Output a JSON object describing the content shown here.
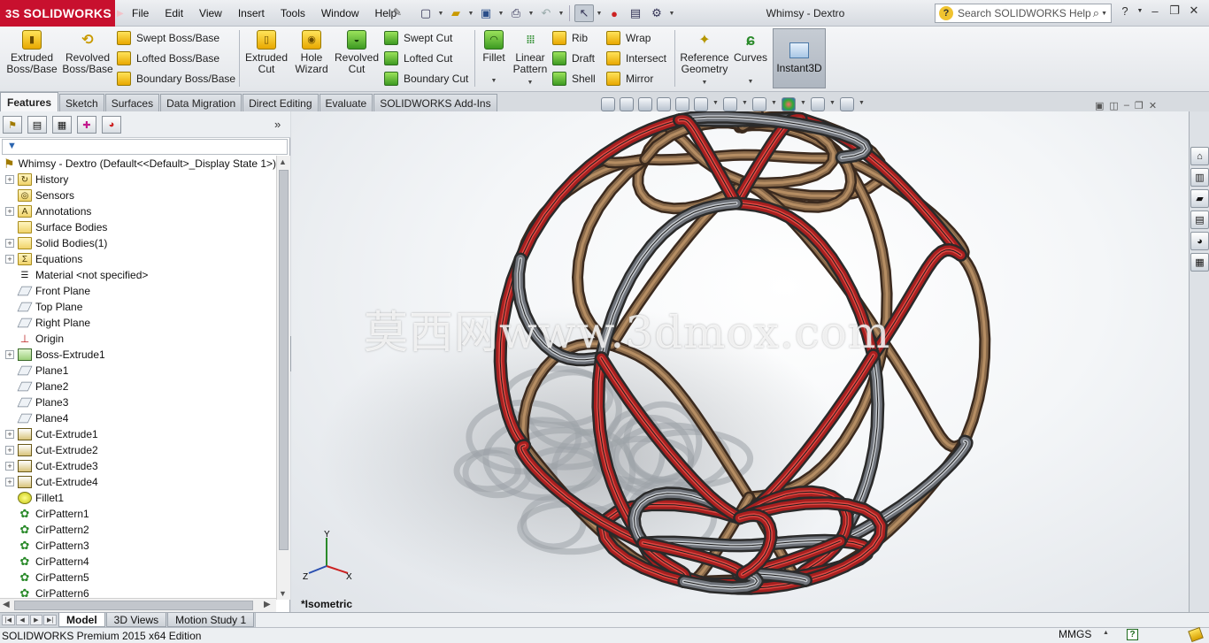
{
  "app": {
    "brand": "SOLIDWORKS",
    "brand_prefix": "3S",
    "window_title": "Whimsy - Dextro",
    "brand_color": "#c8102e"
  },
  "menu": [
    "File",
    "Edit",
    "View",
    "Insert",
    "Tools",
    "Window",
    "Help"
  ],
  "search": {
    "placeholder": "Search SOLIDWORKS Help"
  },
  "ribbon": {
    "extruded_boss": "Extruded Boss/Base",
    "revolved_boss": "Revolved Boss/Base",
    "swept_boss": "Swept Boss/Base",
    "lofted_boss": "Lofted Boss/Base",
    "boundary_boss": "Boundary Boss/Base",
    "extruded_cut": "Extruded Cut",
    "hole_wizard": "Hole Wizard",
    "revolved_cut": "Revolved Cut",
    "swept_cut": "Swept Cut",
    "lofted_cut": "Lofted Cut",
    "boundary_cut": "Boundary Cut",
    "fillet": "Fillet",
    "linear_pattern": "Linear Pattern",
    "rib": "Rib",
    "draft": "Draft",
    "shell": "Shell",
    "wrap": "Wrap",
    "intersect": "Intersect",
    "mirror": "Mirror",
    "reference_geometry": "Reference Geometry",
    "curves": "Curves",
    "instant3d": "Instant3D"
  },
  "command_tabs": [
    "Features",
    "Sketch",
    "Surfaces",
    "Data Migration",
    "Direct Editing",
    "Evaluate",
    "SOLIDWORKS Add-Ins"
  ],
  "tree": {
    "root": "Whimsy - Dextro  (Default<<Default>_Display State 1>)",
    "items": [
      {
        "label": "History",
        "icon": "history-folder-icon",
        "expand": true
      },
      {
        "label": "Sensors",
        "icon": "sensors-folder-icon",
        "expand": false
      },
      {
        "label": "Annotations",
        "icon": "annotations-folder-icon",
        "expand": true
      },
      {
        "label": "Surface Bodies",
        "icon": "surface-bodies-folder-icon",
        "expand": false
      },
      {
        "label": "Solid Bodies(1)",
        "icon": "solid-bodies-folder-icon",
        "expand": true
      },
      {
        "label": "Equations",
        "icon": "equations-folder-icon",
        "expand": true
      },
      {
        "label": "Material <not specified>",
        "icon": "material-icon",
        "expand": false
      },
      {
        "label": "Front Plane",
        "icon": "plane-icon",
        "expand": false
      },
      {
        "label": "Top Plane",
        "icon": "plane-icon",
        "expand": false
      },
      {
        "label": "Right Plane",
        "icon": "plane-icon",
        "expand": false
      },
      {
        "label": "Origin",
        "icon": "origin-icon",
        "expand": false
      },
      {
        "label": "Boss-Extrude1",
        "icon": "boss-extrude-icon",
        "expand": true
      },
      {
        "label": "Plane1",
        "icon": "plane-icon",
        "expand": false
      },
      {
        "label": "Plane2",
        "icon": "plane-icon",
        "expand": false
      },
      {
        "label": "Plane3",
        "icon": "plane-icon",
        "expand": false
      },
      {
        "label": "Plane4",
        "icon": "plane-icon",
        "expand": false
      },
      {
        "label": "Cut-Extrude1",
        "icon": "cut-extrude-icon",
        "expand": true
      },
      {
        "label": "Cut-Extrude2",
        "icon": "cut-extrude-icon",
        "expand": true
      },
      {
        "label": "Cut-Extrude3",
        "icon": "cut-extrude-icon",
        "expand": true
      },
      {
        "label": "Cut-Extrude4",
        "icon": "cut-extrude-icon",
        "expand": true
      },
      {
        "label": "Fillet1",
        "icon": "fillet-icon",
        "expand": false
      },
      {
        "label": "CirPattern1",
        "icon": "circular-pattern-icon",
        "expand": false
      },
      {
        "label": "CirPattern2",
        "icon": "circular-pattern-icon",
        "expand": false
      },
      {
        "label": "CirPattern3",
        "icon": "circular-pattern-icon",
        "expand": false
      },
      {
        "label": "CirPattern4",
        "icon": "circular-pattern-icon",
        "expand": false
      },
      {
        "label": "CirPattern5",
        "icon": "circular-pattern-icon",
        "expand": false
      },
      {
        "label": "CirPattern6",
        "icon": "circular-pattern-icon",
        "expand": false
      }
    ]
  },
  "viewport": {
    "view_label": "*Isometric",
    "watermark": "莫西网www.3dmox.com",
    "axes": {
      "x": "X",
      "y": "Y",
      "z": "Z"
    }
  },
  "bottom_tabs": [
    "Model",
    "3D Views",
    "Motion Study 1"
  ],
  "status": {
    "text": "SOLIDWORKS Premium 2015 x64 Edition",
    "units": "MMGS"
  }
}
